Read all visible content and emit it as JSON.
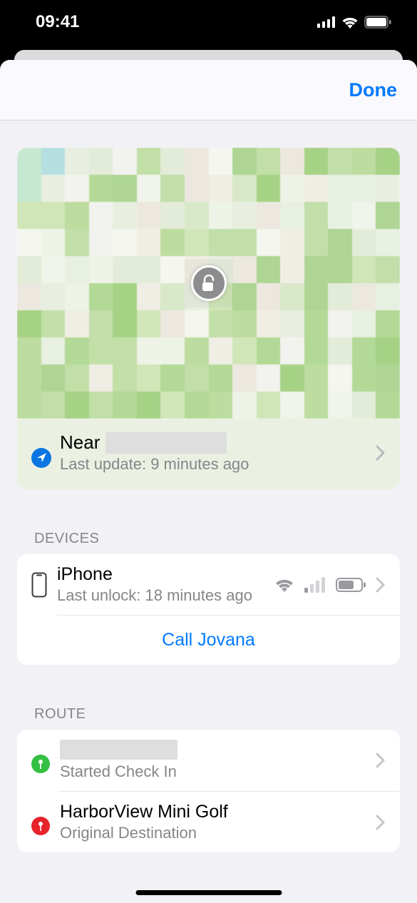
{
  "status": {
    "time": "09:41"
  },
  "nav": {
    "done": "Done"
  },
  "location": {
    "near_prefix": "Near",
    "update": "Last update: 9 minutes ago"
  },
  "devices": {
    "header": "DEVICES",
    "item": {
      "name": "iPhone",
      "sub": "Last unlock: 18 minutes ago"
    },
    "call": "Call Jovana"
  },
  "route": {
    "header": "ROUTE",
    "start": {
      "sub": "Started Check In"
    },
    "destination": {
      "title": "HarborView Mini Golf",
      "sub": "Original Destination"
    }
  }
}
